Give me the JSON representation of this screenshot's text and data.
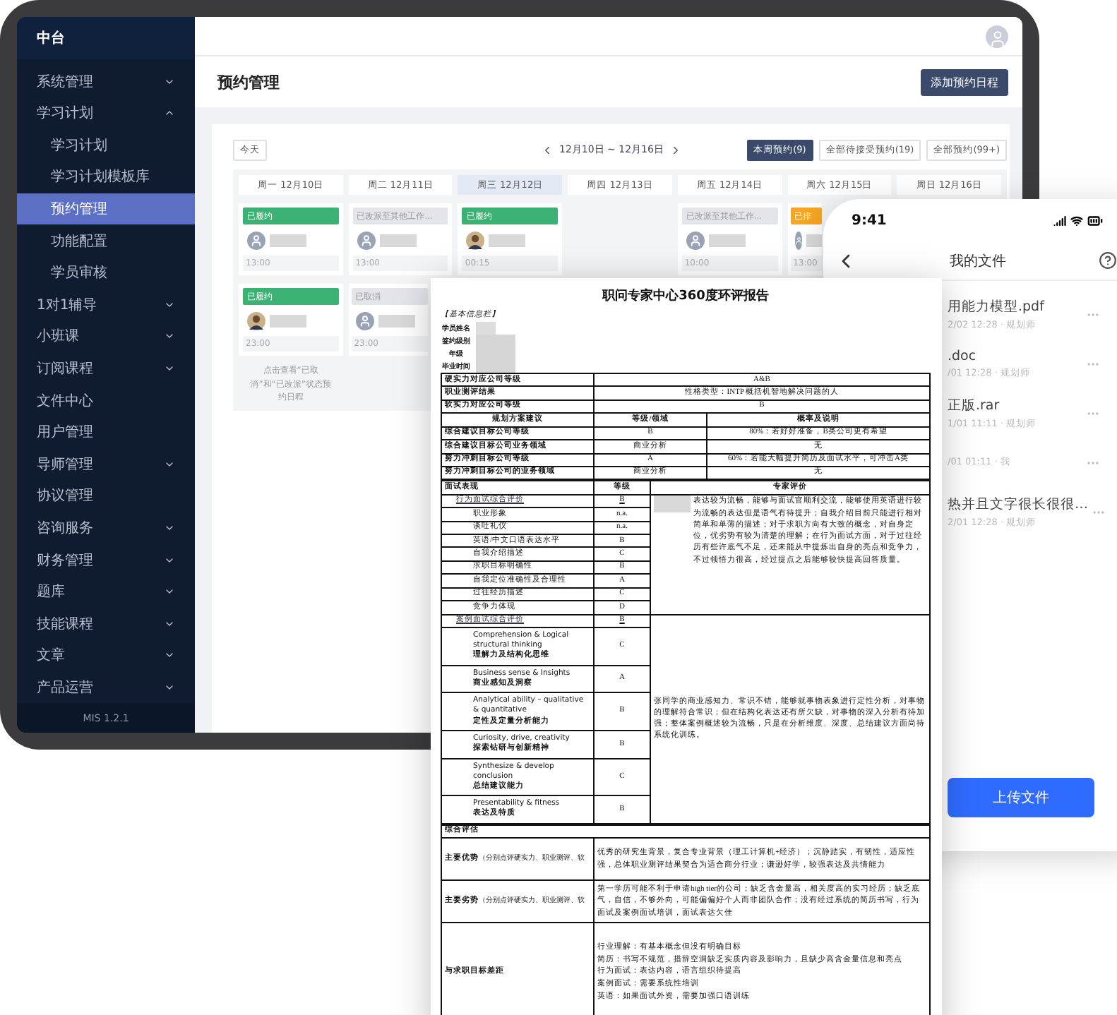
{
  "tablet": {
    "sidebar": {
      "brand": "中台",
      "items": [
        {
          "label": "系统管理",
          "kind": "group",
          "expanded": false,
          "selected": false
        },
        {
          "label": "学习计划",
          "kind": "group",
          "expanded": true,
          "selected": false,
          "children": [
            {
              "label": "学习计划",
              "selected": false
            },
            {
              "label": "学习计划模板库",
              "selected": false
            },
            {
              "label": "预约管理",
              "selected": true
            },
            {
              "label": "功能配置",
              "selected": false
            },
            {
              "label": "学员审核",
              "selected": false
            }
          ]
        },
        {
          "label": "1对1辅导",
          "kind": "group",
          "expanded": false,
          "selected": false
        },
        {
          "label": "小班课",
          "kind": "group",
          "expanded": false,
          "selected": false
        },
        {
          "label": "订阅课程",
          "kind": "group",
          "expanded": false,
          "selected": false
        },
        {
          "label": "文件中心",
          "kind": "link",
          "selected": false
        },
        {
          "label": "用户管理",
          "kind": "link",
          "selected": false
        },
        {
          "label": "导师管理",
          "kind": "group",
          "expanded": false,
          "selected": false
        },
        {
          "label": "协议管理",
          "kind": "link",
          "selected": false
        },
        {
          "label": "咨询服务",
          "kind": "group",
          "expanded": false,
          "selected": false
        },
        {
          "label": "财务管理",
          "kind": "group",
          "expanded": false,
          "selected": false
        },
        {
          "label": "题库",
          "kind": "group",
          "expanded": false,
          "selected": false
        },
        {
          "label": "技能课程",
          "kind": "group",
          "expanded": false,
          "selected": false
        },
        {
          "label": "文章",
          "kind": "group",
          "expanded": false,
          "selected": false
        },
        {
          "label": "产品运营",
          "kind": "group",
          "expanded": false,
          "selected": false
        }
      ],
      "version": "MIS 1.2.1"
    },
    "page": {
      "title": "预约管理",
      "add_button": "添加预约日程"
    },
    "calendar": {
      "today_button": "今天",
      "range": "12月10日 ~ 12月16日",
      "filters": [
        {
          "label": "本周预约(9)",
          "selected": true
        },
        {
          "label": "全部待接受预约(19)",
          "selected": false
        },
        {
          "label": "全部预约(99+)",
          "selected": false
        }
      ],
      "days": [
        {
          "label": "周一 12月10日",
          "selected": false,
          "events": [
            {
              "status": "已履约",
              "kind": "done",
              "photo_avatar": false,
              "time": "13:00"
            },
            {
              "status": "已履约",
              "kind": "done",
              "photo_avatar": true,
              "time": "23:00"
            }
          ]
        },
        {
          "label": "周二 12月11日",
          "selected": false,
          "events": [
            {
              "status": "已改派至其他工作...",
              "kind": "moved",
              "photo_avatar": false,
              "time": "13:00"
            },
            {
              "status": "已取消",
              "kind": "cancelled",
              "photo_avatar": false,
              "time": "23:00"
            }
          ]
        },
        {
          "label": "周三 12月12日",
          "selected": true,
          "events": [
            {
              "status": "已履约",
              "kind": "done",
              "photo_avatar": true,
              "time": "00:15"
            }
          ]
        },
        {
          "label": "周四 12月13日",
          "selected": false
        },
        {
          "label": "周五 12月14日",
          "selected": false,
          "events": [
            {
              "status": "已改派至其他工作...",
              "kind": "moved",
              "photo_avatar": false,
              "time": "10:00"
            }
          ]
        },
        {
          "label": "周六 12月15日",
          "selected": false,
          "events": [
            {
              "status": "已排",
              "kind": "scheduled",
              "photo_avatar": false,
              "time": "13:00"
            }
          ]
        },
        {
          "label": "周日 12月16日",
          "selected": false
        }
      ],
      "note": "点击查看“已取消”和“已改派”状态预约日程"
    }
  },
  "document": {
    "title": "职问专家中心360度环评报告",
    "info_heading": "【基本信息栏】",
    "info_fields": [
      "学员姓名",
      "签约级别",
      "年级",
      "毕业时间"
    ],
    "summary_rows": [
      {
        "label": "硬实力对应公司等级",
        "value": "A&B"
      },
      {
        "label": "职业测评结果",
        "value": "性格类型：INTP 概括机智地解决问题的人"
      },
      {
        "label": "软实力对应公司等级",
        "value": "B"
      }
    ],
    "plan": {
      "columns": [
        "规划方案建议",
        "等级/领域",
        "概率及说明"
      ],
      "rows": [
        {
          "label": "综合建议目标公司等级",
          "level": "B",
          "note": "80%：若好好准备，B类公司更有希望"
        },
        {
          "label": "综合建议目标公司业务领域",
          "level": "商业分析",
          "note": "无"
        },
        {
          "label": "努力冲刺目标公司等级",
          "level": "A",
          "note": "60%：若能大幅提升简历及面试水平，可冲击A类"
        },
        {
          "label": "努力冲刺目标公司的业务领域",
          "level": "商业分析",
          "note": "无"
        }
      ]
    },
    "interview": {
      "columns": [
        "面试表现",
        "等级",
        "专家评价"
      ],
      "sections": [
        {
          "title": "行为面试综合评价",
          "grade": "B",
          "redacted": true,
          "comment": "表达较为流畅，能够与面试官顺利交流，能够使用英语进行较为流畅的表达但是语气有待提升；自我介绍目前只能进行相对简单和单薄的描述；对于求职方向有大致的概念，对自身定位，优劣势有较为清楚的理解；在行为面试方面，对于过往经历有些许底气不足，还未能从中提炼出自身的亮点和竞争力，不过领悟力很高，经过提点之后能够较快提高回答质量。",
          "items": [
            {
              "label": "职业形象",
              "grade": "n.a."
            },
            {
              "label": "谈吐礼仪",
              "grade": "n.a."
            },
            {
              "label": "英语/中文口语表达水平",
              "grade": "B"
            },
            {
              "label": "自我介绍描述",
              "grade": "C"
            },
            {
              "label": "求职目标明确性",
              "grade": "B"
            },
            {
              "label": "自我定位准确性及合理性",
              "grade": "A"
            },
            {
              "label": "过往经历描述",
              "grade": "C"
            },
            {
              "label": "竞争力体现",
              "grade": "D"
            }
          ]
        },
        {
          "title": "案例面试综合评价",
          "grade": "B",
          "comment": "张同学的商业感知力、常识不错，能够就事物表象进行定性分析，对事物的理解符合常识；但在结构化表达还有所欠缺，对事物的深入分析有待加强；整体案例概述较为流畅，只是在分析维度、深度、总结建议方面尚待系统化训练。",
          "items": [
            {
              "label": "Comprehension & Logical structural thinking",
              "label_zh": "理解力及结构化思维",
              "grade": "C"
            },
            {
              "label": "Business sense & Insights",
              "label_zh": "商业感知及洞察",
              "grade": "A"
            },
            {
              "label": "Analytical ability – qualitative & quantitative",
              "label_zh": "定性及定量分析能力",
              "grade": "B"
            },
            {
              "label": "Curiosity, drive, creativity",
              "label_zh": "探索钻研与创新精神",
              "grade": "B"
            },
            {
              "label": "Synthesize & develop conclusion",
              "label_zh": "总结建议能力",
              "grade": "C"
            },
            {
              "label": "Presentability & fitness",
              "label_zh": "表达及特质",
              "grade": "B"
            }
          ]
        }
      ]
    },
    "overall": {
      "heading": "综合评估",
      "rows": [
        {
          "label": "主要优势",
          "hint": "（分别点评硬实力、职业测评、软",
          "lines": [
            "优秀的研究生背景，复合专业背景（理工计算机+经济）；沉静踏实，有韧性，适应性强，总体职业测评结果契合为适合商分行业；谦逊好学，较强表达及共情能力"
          ]
        },
        {
          "label": "主要劣势",
          "hint": "（分别点评硬实力、职业测评、软",
          "lines": [
            "第一学历可能不利于申请high tier的公司；缺乏含金量高，相关度高的实习经历；缺乏底气，自信，不够外向，可能偏偏好个人而非团队合作；没有经过系统的简历书写，行为面试及案例面试培训，面试表达欠佳"
          ]
        },
        {
          "label": "与求职目标差距",
          "lines": [
            "行业理解：有基本概念但没有明确目标",
            "简历：书写不规范，措辞空洞缺乏实质内容及影响力，且缺少高含金量信息和亮点",
            "行为面试：表达内容，语言组织待提高",
            "案例面试：需要系统性培训",
            "英语：如果面试外资，需要加强口语训练"
          ]
        }
      ]
    }
  },
  "phone": {
    "time": "9:41",
    "title": "我的文件",
    "files": [
      {
        "name": "用能力模型.pdf",
        "meta": "2/02 12:28 · 规划师"
      },
      {
        "name": ".doc",
        "meta": "/01 12:28 · 规划师"
      },
      {
        "name": "正版.rar",
        "meta": "1/01 11:11 · 规划师"
      },
      {
        "meta": "/01 01:11 · 我"
      },
      {
        "name": "热并且文字很长很很…",
        "meta": "2/01 12:28 · 规划师"
      }
    ],
    "upload_button": "上传文件"
  }
}
